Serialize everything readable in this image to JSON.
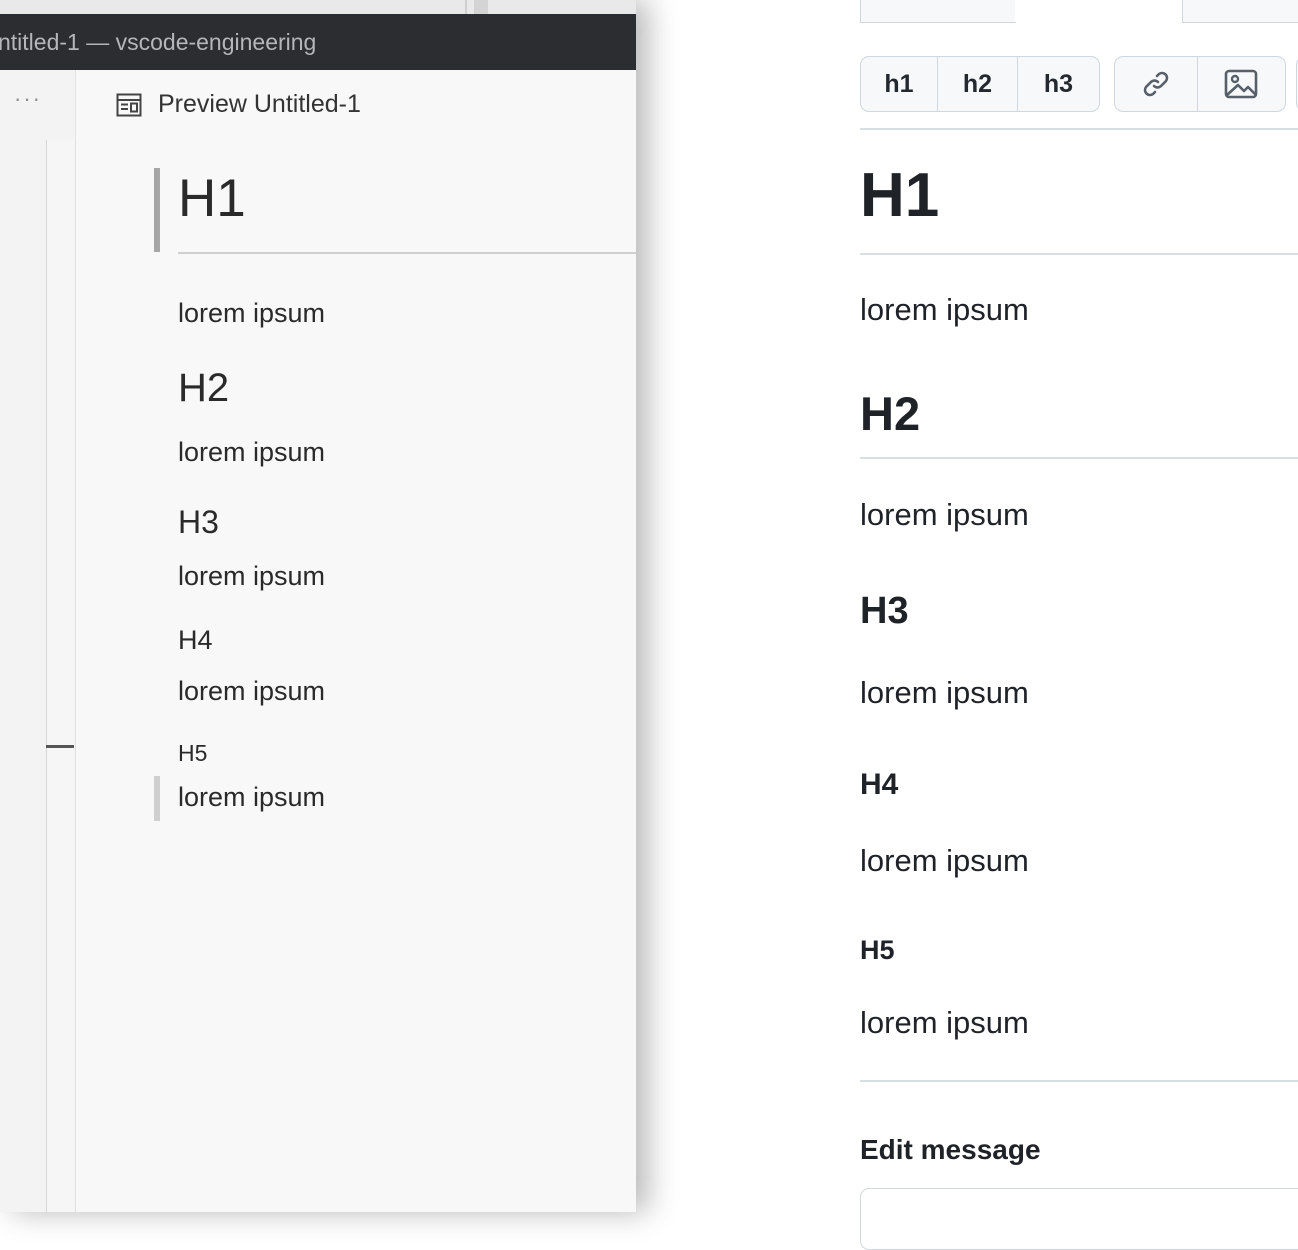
{
  "vscode": {
    "window_title": "ntitled-1 — vscode-engineering",
    "sidebar_more": "···",
    "tab_label": "Preview Untitled-1",
    "preview": {
      "h1": "H1",
      "p1": "lorem ipsum",
      "h2": "H2",
      "p2": "lorem ipsum",
      "h3": "H3",
      "p3": "lorem ipsum",
      "h4": "H4",
      "p4": "lorem ipsum",
      "h5": "H5",
      "p5": "lorem ipsum"
    }
  },
  "github": {
    "toolbar": {
      "h1": "h1",
      "h2": "h2",
      "h3": "h3",
      "link_icon": "link-icon",
      "image_icon": "image-icon"
    },
    "preview": {
      "h1": "H1",
      "p1": "lorem ipsum",
      "h2": "H2",
      "p2": "lorem ipsum",
      "h3": "H3",
      "p3": "lorem ipsum",
      "h4": "H4",
      "p4": "lorem ipsum",
      "h5": "H5",
      "p5": "lorem ipsum"
    },
    "edit_message_label": "Edit message"
  }
}
